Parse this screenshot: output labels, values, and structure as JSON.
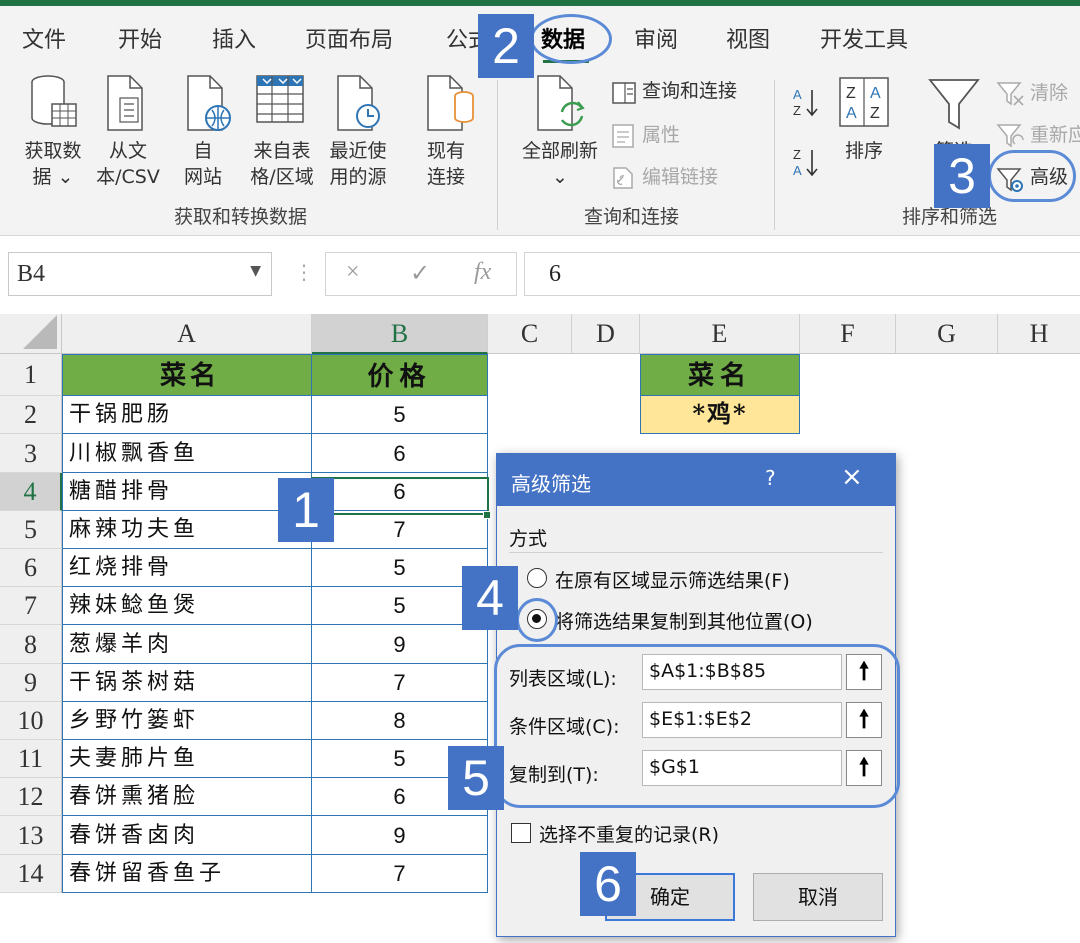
{
  "ribbon": {
    "tabs": [
      "文件",
      "开始",
      "插入",
      "页面布局",
      "公式",
      "数据",
      "审阅",
      "视图",
      "开发工具"
    ],
    "active_tab": "数据",
    "groups": {
      "get_transform": {
        "label": "获取和转换数据",
        "get_data": [
          "获取数",
          "据 ⌄"
        ],
        "from_text": [
          "从文",
          "本/CSV"
        ],
        "from_web": [
          "自",
          "网站"
        ],
        "from_table": [
          "来自表",
          "格/区域"
        ],
        "recent_sources": [
          "最近使",
          "用的源"
        ],
        "existing": [
          "现有",
          "连接"
        ]
      },
      "queries": {
        "label": "查询和连接",
        "refresh_all": [
          "全部刷新",
          "⌄"
        ],
        "queries_connections": "查询和连接",
        "properties": "属性",
        "edit_links": "编辑链接"
      },
      "sort_filter": {
        "label": "排序和筛选",
        "sort": "排序",
        "filter": "筛选",
        "clear": "清除",
        "reapply": "重新应用",
        "advanced": "高级"
      }
    }
  },
  "formula_bar": {
    "name_box": "B4",
    "cancel": "×",
    "enter": "✓",
    "fx": "fx",
    "formula": "6"
  },
  "sheet": {
    "columns": [
      "A",
      "B",
      "C",
      "D",
      "E",
      "F",
      "G",
      "H"
    ],
    "row_numbers": [
      "1",
      "2",
      "3",
      "4",
      "5",
      "6",
      "7",
      "8",
      "9",
      "10",
      "11",
      "12",
      "13",
      "14"
    ],
    "header": {
      "name": "菜名",
      "price": "价格"
    },
    "rows": [
      {
        "name": "干锅肥肠",
        "price": "5"
      },
      {
        "name": "川椒飘香鱼",
        "price": "6"
      },
      {
        "name": "糖醋排骨",
        "price": "6"
      },
      {
        "name": "麻辣功夫鱼",
        "price": "7"
      },
      {
        "name": "红烧排骨",
        "price": "5"
      },
      {
        "name": "辣妹鲶鱼煲",
        "price": "5"
      },
      {
        "name": "葱爆羊肉",
        "price": "9"
      },
      {
        "name": "干锅茶树菇",
        "price": "7"
      },
      {
        "name": "乡野竹篓虾",
        "price": "8"
      },
      {
        "name": "夫妻肺片鱼",
        "price": "5"
      },
      {
        "name": "春饼熏猪脸",
        "price": "6"
      },
      {
        "name": "春饼香卤肉",
        "price": "9"
      },
      {
        "name": "春饼留香鱼子",
        "price": "7"
      }
    ],
    "criteria": {
      "header": "菜名",
      "value": "*鸡*"
    },
    "selected_cell": "B4"
  },
  "dialog": {
    "title": "高级筛选",
    "help": "?",
    "close": "×",
    "mode_label": "方式",
    "option_inplace": "在原有区域显示筛选结果(F)",
    "option_copy": "将筛选结果复制到其他位置(O)",
    "selected_option": "copy",
    "list_range_label": "列表区域(L):",
    "list_range_value": "$A$1:$B$85",
    "criteria_range_label": "条件区域(C):",
    "criteria_range_value": "$E$1:$E$2",
    "copy_to_label": "复制到(T):",
    "copy_to_value": "$G$1",
    "range_button": "🠕",
    "unique_label": "选择不重复的记录(R)",
    "unique_checked": false,
    "ok": "确定",
    "cancel": "取消"
  },
  "steps": [
    "1",
    "2",
    "3",
    "4",
    "5",
    "6"
  ],
  "colors": {
    "excel_green": "#217346",
    "header_fill": "#70ad47",
    "criteria_fill": "#ffe699",
    "dialog_title": "#4472c4",
    "badge": "#4472c4"
  }
}
